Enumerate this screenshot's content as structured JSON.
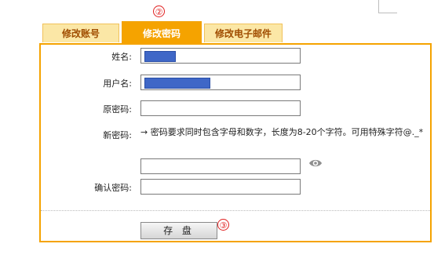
{
  "tabs": [
    {
      "label": "修改账号"
    },
    {
      "label": "修改密码"
    },
    {
      "label": "修改电子邮件"
    }
  ],
  "markers": {
    "tab": "②",
    "save": "③"
  },
  "form": {
    "name_label": "姓名:",
    "username_label": "用户名:",
    "old_password_label": "原密码:",
    "new_password_label": "新密码:",
    "password_hint": "→ 密码要求同时包含字母和数字，长度为8-20个字符。可用特殊字符@._*",
    "confirm_password_label": "确认密码:",
    "save_label": "存 盘"
  },
  "icons": {
    "show_password": "eye-icon"
  },
  "colors": {
    "accent": "#f5a300",
    "tab_inactive": "#fbe7a6",
    "marker": "#e02020",
    "redaction": "#3f67c7"
  }
}
